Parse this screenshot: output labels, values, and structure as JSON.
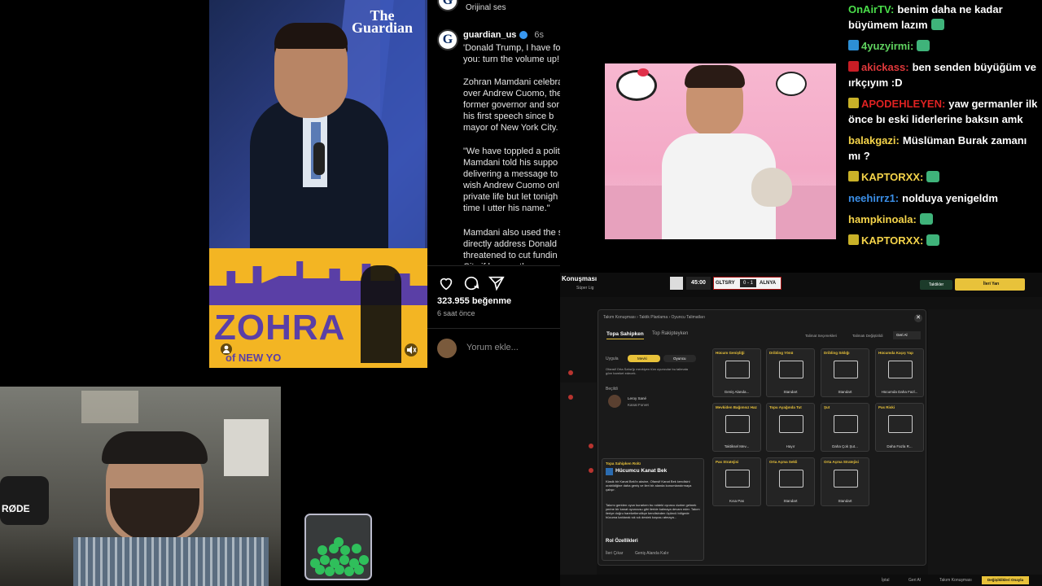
{
  "video": {
    "logo_line1": "The",
    "logo_line2": "Guardian",
    "podium_text": "ZOHRA",
    "podium_sub": "of NEW YO"
  },
  "instagram": {
    "prev_audio": "Orijinal ses",
    "username": "guardian_us",
    "time": "6s",
    "caption_p1": "'Donald Trump, I have fo you: turn the volume up!",
    "caption_p2": "Zohran Mamdani celebra over Andrew Cuomo, the former governor and sor in his first speech since b mayor of New York City.",
    "caption_p3": "\"We have toppled a polit Mamdani told his suppo delivering a message to wish Andrew Cuomo onl private life but let tonigh time I utter his name.\"",
    "caption_p4": "Mamdani also used the s directly address Donald threatened to cut fundin City if he won the",
    "likes": "323.955 beğenme",
    "posted": "6 saat önce",
    "comment_placeholder": "Yorum ekle..."
  },
  "chat": [
    {
      "user": "OnAirTV:",
      "color": "#4ade4a",
      "text": "benim daha ne kadar büyümem lazım",
      "badge": "",
      "emote": true
    },
    {
      "user": "4yuzyirmi:",
      "color": "#5fd35f",
      "text": "",
      "badge": "#2d8fd5",
      "emote": true
    },
    {
      "user": "akickass:",
      "color": "#e0383b",
      "text": "ben senden büyüğüm ve ırkçıyım :D",
      "badge": "#c81d25",
      "emote": false
    },
    {
      "user": "APODEHLEYEN:",
      "color": "#e02222",
      "text": "yaw germanler ilk önce bı eski liderlerine baksın amk",
      "badge": "#c9b128",
      "emote": false
    },
    {
      "user": "balakgazi:",
      "color": "#f5d44a",
      "text": "Müslüman Burak zamanı mı ?",
      "badge": "",
      "emote": false
    },
    {
      "user": "KAPTORXX:",
      "color": "#f5d44a",
      "text": "",
      "badge": "#c9b128",
      "emote": true
    },
    {
      "user": "neehirrz1:",
      "color": "#3b8fe8",
      "text": "nolduya yenigeldm",
      "badge": "",
      "emote": false
    },
    {
      "user": "hampkinoala:",
      "color": "#f5d44a",
      "text": "",
      "badge": "",
      "emote": true
    },
    {
      "user": "KAPTORXX:",
      "color": "#f5d44a",
      "text": "",
      "badge": "#c9b128",
      "emote": true
    }
  ],
  "game": {
    "title": "Konuşması",
    "league": "Süper Lig",
    "clock": "45:00",
    "home": "GLTSRY",
    "score": "0 - 1",
    "away": "ALNYA",
    "btn_tactics": "Taktikler",
    "btn_next": "İleri Yarı",
    "breadcrumb": "Takım Konuşması  ›  Taktik Planlama  ›  Oyuncu Talimatları",
    "tab1": "Topa Sahipken",
    "tab2": "Top Rakipteyken",
    "opt1": "Talimat Seçenekleri",
    "opt2": "Talimatı Değiştirildi",
    "opt_back": "Geri Al",
    "apply_label": "Uygula",
    "apply_position": "Mevki",
    "apply_player": "Oyuncu",
    "apply_desc": "Ofansif Orta Saha'ğı mevkiyen tüm oyuncular bu talimata göre hareket edecek.",
    "selected_label": "Beçildi",
    "player_name": "Leroy Sané",
    "player_pos": "Kanat Forvet",
    "role_section": "Topa Sahipken Rolü",
    "role_name": "Hücumcu Kanat Bek",
    "role_desc1": "Klasik bir Kanat Bek'in aksine, Ofansif Kanat Bek kendisini orabildiğine daha geniş ve ileri bir alanda konumlandırmaya çalışır.",
    "role_desc2": "Takımı geriden oyun kurarken bu roldeki oyuncu dərine gelmek yerine bir kanat oyuncusu gibi ileride kalmaya devam eder. Takım ileriye doğru hareketlendikçe kendisinden üçüncü bölgede hücuma katılarak sık sık destek koşusu atmaya...",
    "role_features": "Rol Özellikleri",
    "feature1": "İleri Çıkar",
    "feature2": "Geniş Alanda Kalır",
    "cards": [
      {
        "title": "Hücum Genişliği",
        "value": "Geniş Alanda..."
      },
      {
        "title": "Dribling Yönü",
        "value": "Standart"
      },
      {
        "title": "Dribling Sıklığı",
        "value": "Standart"
      },
      {
        "title": "Hücumda Kaçış Yap",
        "value": "Hücumda Daha Fazl..."
      },
      {
        "title": "Mevkiden Bağımsız Haz",
        "value": "Taktiksel Mev..."
      },
      {
        "title": "Topu Ayağında Tut",
        "value": "Hayır"
      },
      {
        "title": "Şut",
        "value": "Daha Çok Şut..."
      },
      {
        "title": "Pas Riski",
        "value": "Daha Fazla R..."
      },
      {
        "title": "Pas Stratejisi",
        "value": "Kısa Pas"
      },
      {
        "title": "Orta Açma Sekli",
        "value": "Standart"
      },
      {
        "title": "Orta Açma Stratejisi",
        "value": "Standart"
      }
    ],
    "bottom_cancel": "İptal",
    "bottom_undo": "Geri Al",
    "bottom_talk": "Takım Konuşması",
    "bottom_confirm": "Değişiklikleri Onayla"
  }
}
